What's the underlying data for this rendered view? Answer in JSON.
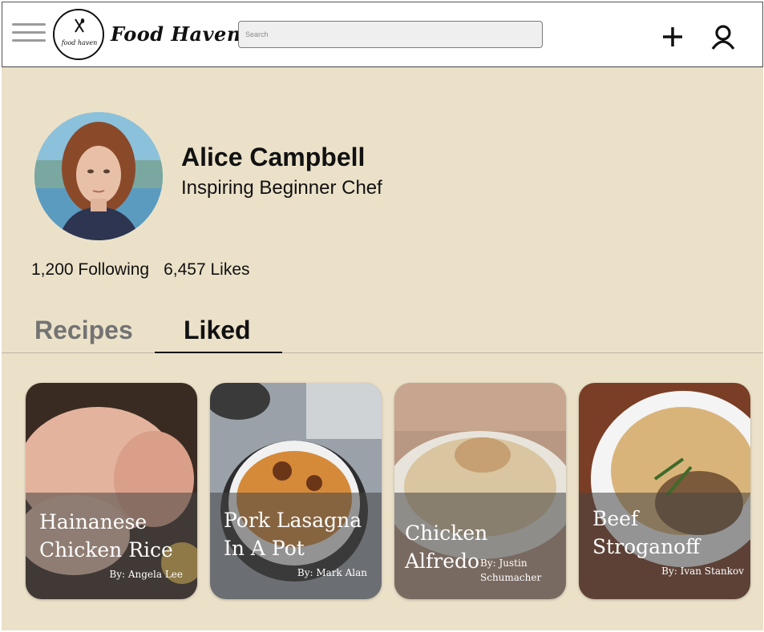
{
  "app": {
    "brand_name": "Food Haven",
    "logo_text": "food haven"
  },
  "header": {
    "search_placeholder": "Search",
    "menu_icon": "hamburger-menu-icon",
    "add_icon": "plus-icon",
    "profile_icon": "user-icon"
  },
  "profile": {
    "name": "Alice Campbell",
    "subtitle": "Inspiring Beginner Chef",
    "following": "1,200 Following",
    "likes": "6,457 Likes"
  },
  "tabs": [
    {
      "label": "Recipes",
      "active": false
    },
    {
      "label": "Liked",
      "active": true
    }
  ],
  "cards": [
    {
      "title": "Hainanese Chicken Rice",
      "author": "By: Angela Lee"
    },
    {
      "title": "Pork Lasagna In A Pot",
      "author": "By: Mark Alan"
    },
    {
      "title": "Chicken Alfredo",
      "author": "By: Justin Schumacher"
    },
    {
      "title": "Beef Stroganoff",
      "author": "By: Ivan Stankov"
    }
  ],
  "colors": {
    "page_background": "#ebe1c9",
    "header_background": "#ffffff",
    "text": "#111111",
    "inactive_tab": "#737373"
  }
}
